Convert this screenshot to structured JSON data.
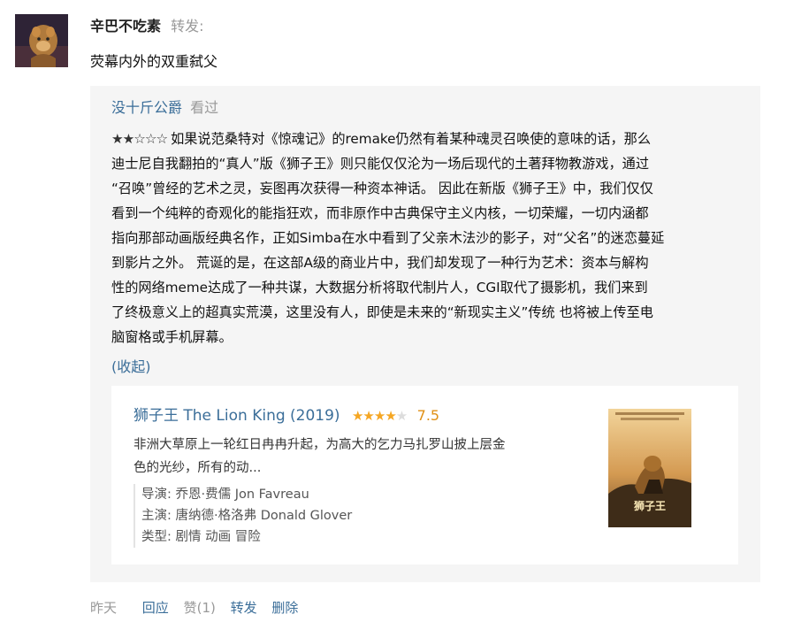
{
  "header": {
    "username": "辛巴不吃素",
    "action": "转发:"
  },
  "repost_text": "荧幕内外的双重弑父",
  "quote": {
    "user": "没十斤公爵",
    "action": "看过",
    "review_stars": "★★☆☆☆",
    "review_lines": [
      "如果说范桑特对《惊魂记》的remake仍然有着某种魂灵召唤使的意味的话，那么",
      "迪士尼自我翻拍的“真人”版《狮子王》则只能仅仅沦为一场后现代的土著拜物教游戏，通过",
      "“召唤”曾经的艺术之灵，妄图再次获得一种资本神话。 因此在新版《狮子王》中，我们仅仅",
      "看到一个纯粹的奇观化的能指狂欢，而非原作中古典保守主义内核，一切荣耀，一切内涵都",
      "指向那部动画版经典名作，正如Simba在水中看到了父亲木法沙的影子，对“父名”的迷恋蔓延",
      "到影片之外。 荒诞的是，在这部A级的商业片中，我们却发现了一种行为艺术：资本与解构",
      "性的网络meme达成了一种共谋，大数据分析将取代制片人，CGI取代了摄影机，我们来到",
      "了终极意义上的超真实荒漠，这里没有人，即使是未来的“新现实主义”传统 也将被上传至电",
      "脑窗格或手机屏幕。"
    ],
    "collapse_label": "(收起)"
  },
  "movie": {
    "title": "狮子王 The Lion King (2019)",
    "stars_filled": "★★★★",
    "stars_empty": "★",
    "rating": "7.5",
    "desc_line1": "非洲大草原上一轮红日冉冉升起，为高大的乞力马扎罗山披上层金",
    "desc_line2": "色的光纱，所有的动...",
    "director": "导演: 乔恩·费儒 Jon Favreau",
    "cast": "主演: 唐纳德·格洛弗 Donald Glover",
    "genre": "类型: 剧情 动画 冒险",
    "poster_title": "狮子王"
  },
  "footer": {
    "time": "昨天",
    "reply": "回应",
    "like": "赞(1)",
    "repost": "转发",
    "delete": "删除"
  },
  "colors": {
    "link": "#3b6e99",
    "muted": "#999999",
    "star": "#f5a623",
    "rating": "#e09015",
    "quote_bg": "#f5f5f5"
  }
}
